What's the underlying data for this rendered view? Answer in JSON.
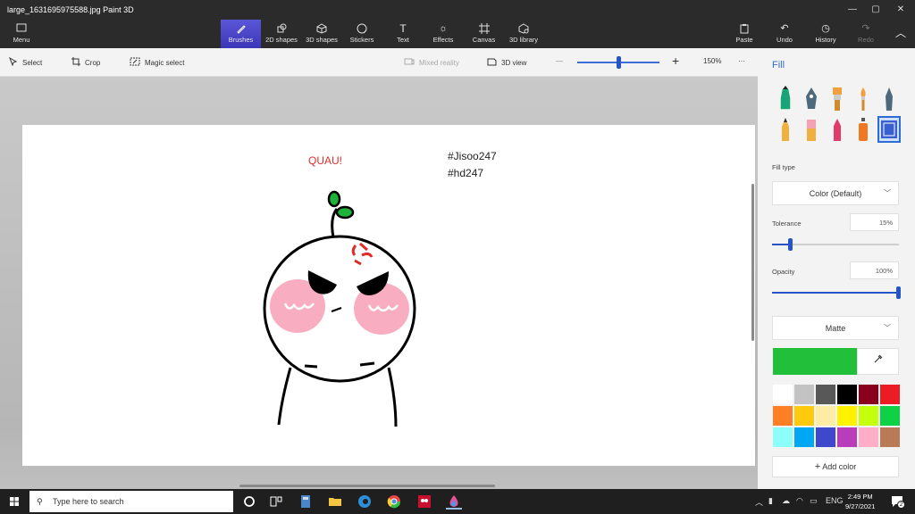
{
  "window": {
    "title": "large_1631695975588.jpg   Paint 3D"
  },
  "ribbon": {
    "menu_label": "Menu",
    "tabs": [
      {
        "label": "Brushes",
        "icon": "brush-icon",
        "active": true
      },
      {
        "label": "2D shapes",
        "icon": "2d-shapes-icon"
      },
      {
        "label": "3D shapes",
        "icon": "3d-shapes-icon"
      },
      {
        "label": "Stickers",
        "icon": "stickers-icon"
      },
      {
        "label": "Text",
        "icon": "text-icon"
      },
      {
        "label": "Effects",
        "icon": "effects-icon"
      },
      {
        "label": "Canvas",
        "icon": "canvas-icon"
      },
      {
        "label": "3D library",
        "icon": "3d-library-icon"
      }
    ],
    "right_actions": [
      {
        "label": "Paste",
        "icon": "paste-icon"
      },
      {
        "label": "Undo",
        "icon": "undo-icon"
      },
      {
        "label": "History",
        "icon": "history-icon"
      },
      {
        "label": "Redo",
        "icon": "redo-icon",
        "disabled": true
      }
    ]
  },
  "toolbar": {
    "select_label": "Select",
    "crop_label": "Crop",
    "magic_select_label": "Magic select",
    "mixed_reality_label": "Mixed reality",
    "view3d_label": "3D view",
    "zoom_minus": "—",
    "zoom_plus": "+",
    "zoom_value": "150%",
    "more": "···"
  },
  "canvas": {
    "drawing_text": "QUAU!",
    "hashtag_1": "#Jisoo247",
    "hashtag_2": "#hd247",
    "anger_mark": "꒰"
  },
  "panel": {
    "heading": "Fill",
    "fill_type_label": "Fill type",
    "fill_type_value": "Color (Default)",
    "tolerance_label": "Tolerance",
    "tolerance_value": "15%",
    "tolerance_level": 0.15,
    "opacity_label": "Opacity",
    "opacity_value": "100%",
    "opacity_level": 1.0,
    "finish_value": "Matte",
    "current_color": "#22c03a",
    "palette": [
      "#ffffff",
      "#c3c3c3",
      "#585858",
      "#000000",
      "#88001b",
      "#ec1c24",
      "#ff7f27",
      "#ffc90e",
      "#fdeca6",
      "#fff200",
      "#c4ff0e",
      "#0ed145",
      "#8cfffb",
      "#00a8f3",
      "#3f48cc",
      "#b83dba",
      "#ffaec8",
      "#b97a56"
    ],
    "add_color_label": "Add color"
  },
  "taskbar": {
    "search_placeholder": "Type here to search",
    "language": "ENG",
    "time": "2:49 PM",
    "date": "9/27/2021",
    "notification_count": "2"
  }
}
